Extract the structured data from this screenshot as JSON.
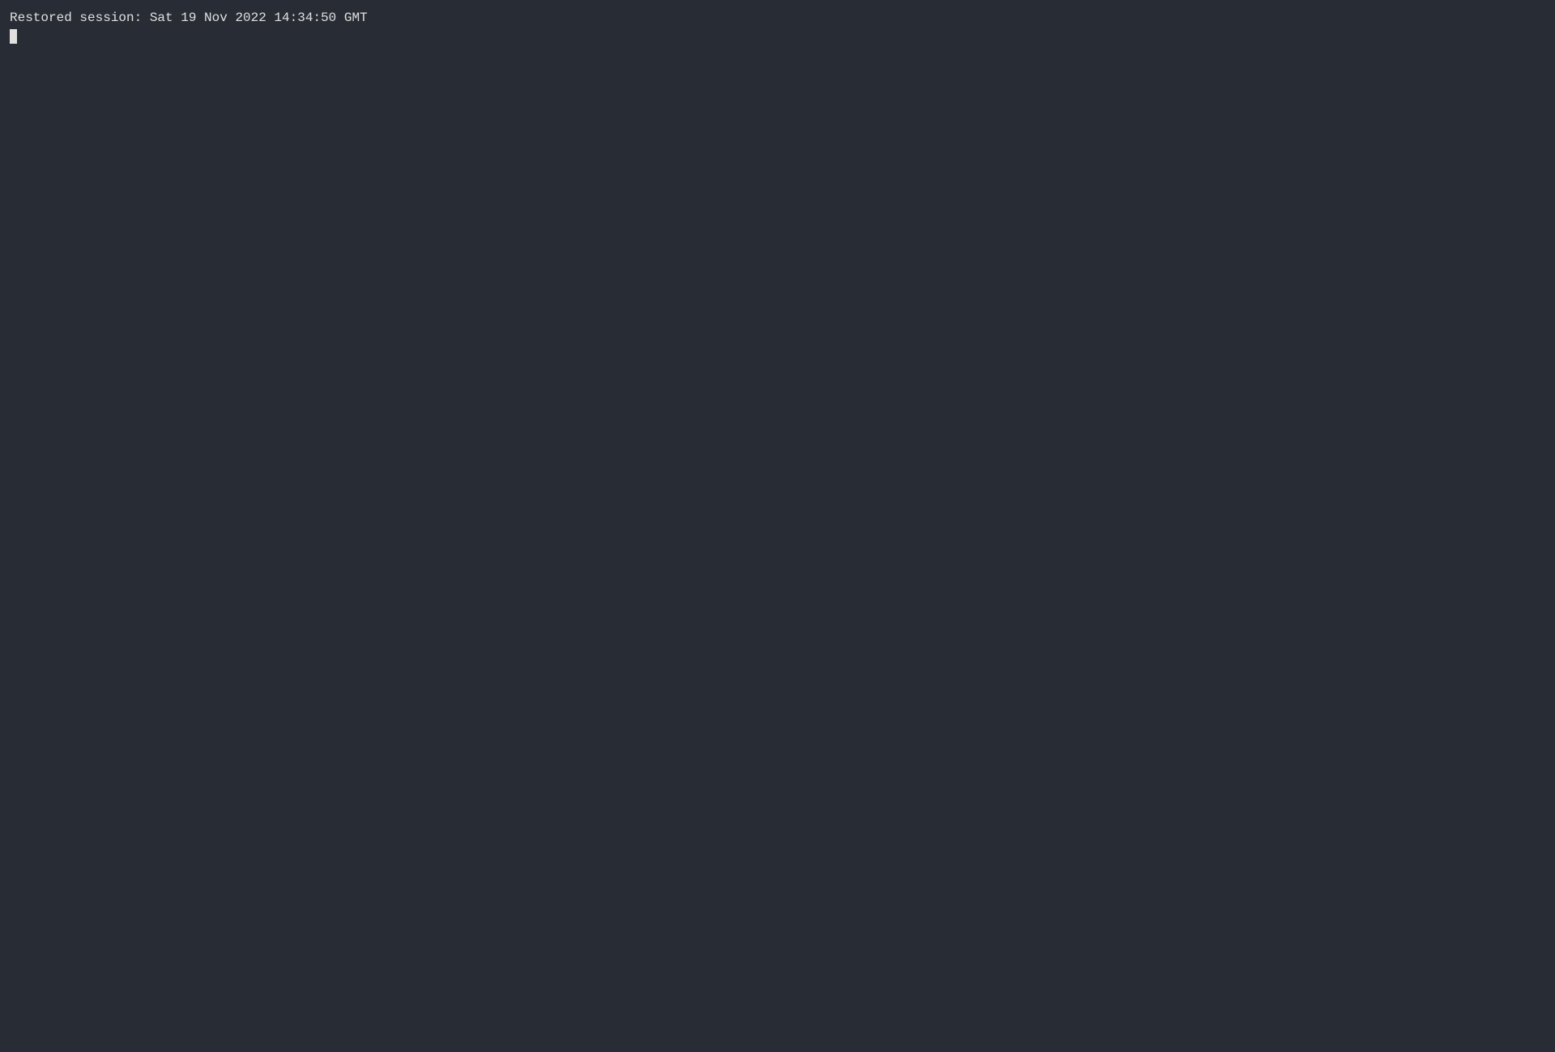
{
  "terminal": {
    "background_color": "#282c34",
    "text_color": "#e0e0e0",
    "font_family": "monospace",
    "lines": [
      {
        "text": "Restored session: Sat 19 Nov 2022 14:34:50 GMT",
        "type": "output"
      }
    ],
    "cursor_visible": true
  }
}
